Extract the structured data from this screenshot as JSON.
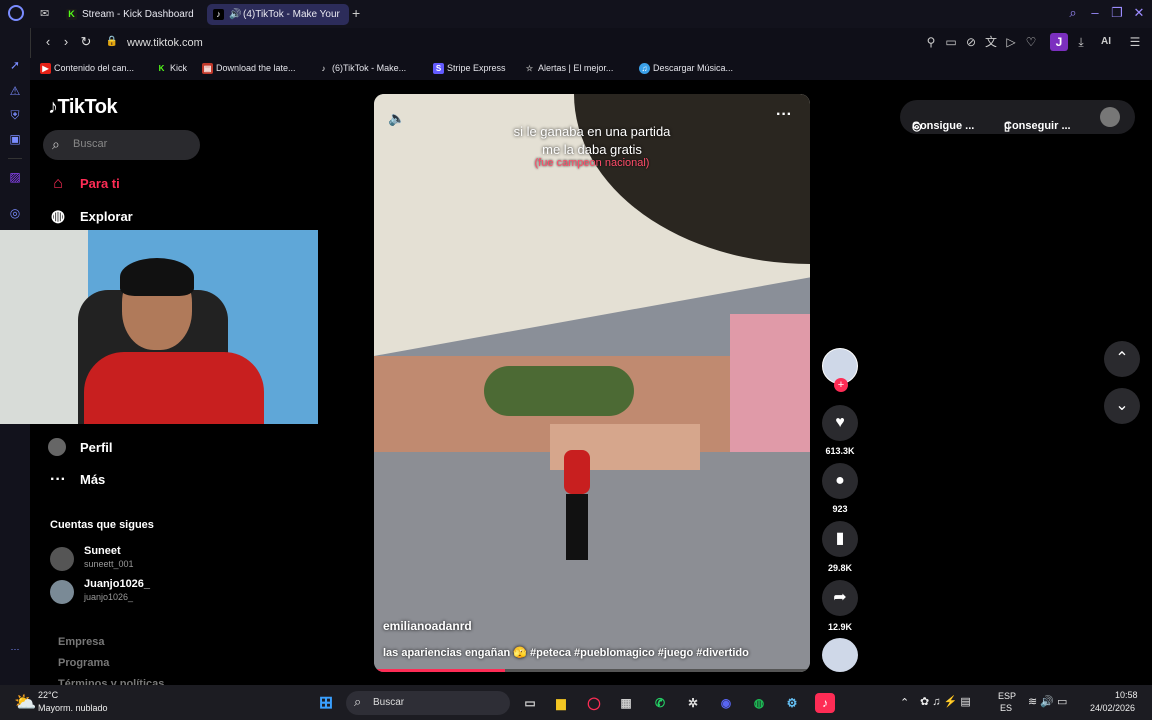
{
  "browser": {
    "tabs": [
      {
        "label": "Stream - Kick Dashboard"
      },
      {
        "label": "(4)TikTok - Make Your"
      }
    ],
    "url": "www.tiktok.com",
    "bookmarks": [
      "Contenido del can...",
      "Kick",
      "Download the late...",
      "(6)TikTok - Make...",
      "Stripe Express",
      "Alertas | El mejor...",
      "Descargar Música..."
    ],
    "profile_letter": "J",
    "ai_label": "AI"
  },
  "sidebar": {
    "logo": "TikTok",
    "search_placeholder": "Buscar",
    "nav": [
      {
        "label": "Para ti",
        "icon": "home-icon",
        "active": true
      },
      {
        "label": "Explorar",
        "icon": "compass-icon"
      },
      {
        "label": "Perfil",
        "icon": "profile-icon"
      },
      {
        "label": "Más",
        "icon": "more-icon"
      }
    ],
    "following_title": "Cuentas que sigues",
    "following": [
      {
        "name": "Suneet",
        "handle": "suneett_001"
      },
      {
        "name": "Juanjo1026_",
        "handle": "juanjo1026_"
      }
    ],
    "footer": [
      "Empresa",
      "Programa",
      "Términos y políticas"
    ]
  },
  "video": {
    "caption_line1": "si le ganaba en una partida",
    "caption_line2": "me la daba gratis",
    "caption_line3": "(fue campeon nacional)",
    "author": "emilianoadanrd",
    "description": "las apariencias engañan 🫣 #peteca #pueblomagico #juego #divertido",
    "progress": 0.3
  },
  "actions": {
    "likes": "613.3K",
    "comments": "923",
    "saves": "29.8K",
    "shares": "12.9K"
  },
  "getapp": {
    "coins": "Consigue ...",
    "app": "Conseguir ..."
  },
  "taskbar": {
    "weather_temp": "22°C",
    "weather_desc": "Mayorm. nublado",
    "search": "Buscar",
    "lang1": "ESP",
    "lang2": "ES",
    "time": "10:58",
    "date": "24/02/2026"
  },
  "colors": {
    "accent": "#fe2c55",
    "opera": "#7a8cff"
  }
}
